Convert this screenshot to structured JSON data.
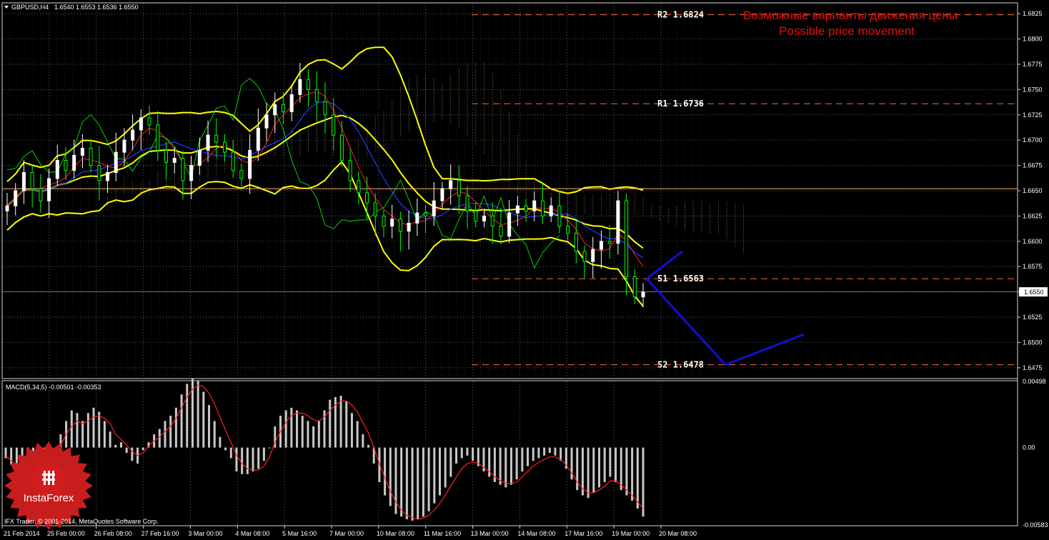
{
  "header": {
    "symbol": "GBPUSD,H4",
    "ohlc": "1.6540 1.6553 1.6536 1.6550"
  },
  "macd_header": {
    "label": "MACD(5,34,5)",
    "values": "-0.00501 -0.00353"
  },
  "footer": {
    "copyright": "IFX Trader, © 2001-2014, MetaQuotes Software Corp."
  },
  "annotation": {
    "line1": "Возможные варианты движения цены",
    "line2": "Possible price movement"
  },
  "logo": {
    "text": "InstaForex"
  },
  "colors": {
    "background": "#000000",
    "grid": "#7a8a8a",
    "bull": "#ffffff",
    "bear": "#00ff00",
    "bollinger": "#ffff00",
    "signal": "#ff2020",
    "kijun": "#1e3cff",
    "level_line": "#ff6a3a",
    "forecast": "#1010d0",
    "annotation": "#e01010",
    "current_price": "#8899aa",
    "hline": "#ffb060"
  },
  "levels": [
    {
      "name": "R2",
      "value": 1.6824,
      "label": "R2 1.6824"
    },
    {
      "name": "R1",
      "value": 1.6736,
      "label": "R1 1.6736"
    },
    {
      "name": "S1",
      "value": 1.6563,
      "label": "S1 1.6563"
    },
    {
      "name": "S2",
      "value": 1.6478,
      "label": "S2 1.6478"
    }
  ],
  "current_price": {
    "value": 1.655,
    "label": "1.6550"
  },
  "chart_data": [
    {
      "type": "line",
      "title": "GBPUSD,H4",
      "ylim": [
        1.6465,
        1.6835
      ],
      "y_ticks": [
        "1.6825",
        "1.6800",
        "1.6775",
        "1.6750",
        "1.6725",
        "1.6700",
        "1.6675",
        "1.6650",
        "1.6625",
        "1.6600",
        "1.6575",
        "1.6550",
        "1.6525",
        "1.6500",
        "1.6475"
      ],
      "x_ticks": [
        "21 Feb 2014",
        "25 Feb 00:00",
        "26 Feb 08:00",
        "27 Feb 16:00",
        "3 Mar 00:00",
        "4 Mar 08:00",
        "5 Mar 16:00",
        "7 Mar 00:00",
        "10 Mar 08:00",
        "11 Mar 16:00",
        "13 Mar 00:00",
        "14 Mar 08:00",
        "17 Mar 16:00",
        "19 Mar 00:00",
        "20 Mar 08:00"
      ],
      "grid": true,
      "horizontal_line": 1.6652,
      "series": [
        {
          "values": [
            1.6635,
            1.665,
            1.6668,
            1.6652,
            1.664,
            1.6662,
            1.668,
            1.667,
            1.6685,
            1.6692,
            1.6675,
            1.666,
            1.6668,
            1.6688,
            1.67,
            1.671,
            1.6722,
            1.6715,
            1.669,
            1.6678,
            1.6682,
            1.666,
            1.6675,
            1.669,
            1.6705,
            1.6698,
            1.6688,
            1.667,
            1.6662,
            1.669,
            1.6712,
            1.6725,
            1.6735,
            1.6728,
            1.6745,
            1.676,
            1.675,
            1.6738,
            1.6725,
            1.6705,
            1.668,
            1.666,
            1.6648,
            1.6638,
            1.6625,
            1.6615,
            1.6622,
            1.661,
            1.6618,
            1.6628,
            1.6625,
            1.664,
            1.6652,
            1.666,
            1.6645,
            1.663,
            1.662,
            1.6625,
            1.6615,
            1.6605,
            1.6628,
            1.6635,
            1.663,
            1.664,
            1.6625,
            1.6635,
            1.6615,
            1.6608,
            1.659,
            1.658,
            1.6592,
            1.66,
            1.6598,
            1.664,
            1.6565,
            1.6545,
            1.655
          ]
        }
      ]
    },
    {
      "type": "bar",
      "title": "MACD(5,34,5)",
      "ylim": [
        -0.00583,
        0.00498
      ],
      "y_ticks": [
        "0.00498",
        "0.00",
        "-0.00583"
      ],
      "series": [
        {
          "name": "MACD",
          "values": [
            -0.0008,
            -0.0013,
            -0.0016,
            -0.0015,
            -0.001,
            -0.0012,
            -0.0014,
            -0.0011,
            -0.0008,
            -0.0006,
            0.001,
            0.002,
            0.0028,
            0.0026,
            0.002,
            0.0026,
            0.003,
            0.0027,
            0.002,
            0.0012,
            0.0002,
            0.0004,
            -0.0004,
            -0.001,
            -0.0012,
            -0.0002,
            0.0004,
            0.001,
            0.0014,
            0.002,
            0.0024,
            0.003,
            0.004,
            0.0048,
            0.0052,
            0.005,
            0.0042,
            0.0032,
            0.002,
            0.0008,
            -0.0002,
            -0.0008,
            -0.0018,
            -0.002,
            -0.002,
            -0.0018,
            -0.0016,
            -0.001,
            0.0,
            0.0016,
            0.0024,
            0.0028,
            0.003,
            0.0028,
            0.0024,
            0.002,
            0.0016,
            0.002,
            0.0028,
            0.0036,
            0.0038,
            0.0039,
            0.0035,
            0.0026,
            0.002,
            0.001,
            0.0002,
            -0.0012,
            -0.0026,
            -0.0036,
            -0.0044,
            -0.005,
            -0.0052,
            -0.0054,
            -0.0055,
            -0.0054,
            -0.0052,
            -0.0048,
            -0.0042,
            -0.0036,
            -0.003,
            -0.0022,
            -0.0012,
            -0.0008,
            -0.0006,
            -0.001,
            -0.0014,
            -0.0018,
            -0.0022,
            -0.0026,
            -0.0028,
            -0.003,
            -0.0028,
            -0.0024,
            -0.0018,
            -0.0014,
            -0.001,
            -0.0008,
            -0.0006,
            -0.0004,
            -0.0006,
            -0.001,
            -0.0016,
            -0.0024,
            -0.0032,
            -0.0036,
            -0.0038,
            -0.0034,
            -0.003,
            -0.0026,
            -0.0022,
            -0.0026,
            -0.0032,
            -0.0036,
            -0.004,
            -0.0046,
            -0.0052
          ]
        },
        {
          "name": "Signal",
          "values": [
            -0.0006,
            -0.001,
            -0.0013,
            -0.0014,
            -0.0013,
            -0.0012,
            -0.0012,
            -0.0011,
            -0.0009,
            -0.0006,
            0.0002,
            0.001,
            0.0016,
            0.002,
            0.0018,
            0.002,
            0.0023,
            0.0024,
            0.0022,
            0.0018,
            0.001,
            0.0006,
            0.0002,
            -0.0003,
            -0.0006,
            -0.0004,
            0.0001,
            0.0005,
            0.0008,
            0.0012,
            0.0016,
            0.0022,
            0.003,
            0.0038,
            0.0044,
            0.0047,
            0.0046,
            0.0041,
            0.0033,
            0.0023,
            0.0013,
            0.0004,
            -0.0006,
            -0.0012,
            -0.0016,
            -0.0017,
            -0.0017,
            -0.0014,
            -0.0007,
            0.0004,
            0.0012,
            0.0019,
            0.0024,
            0.0026,
            0.0026,
            0.0024,
            0.0021,
            0.002,
            0.0023,
            0.0028,
            0.0032,
            0.0035,
            0.0035,
            0.0032,
            0.0027,
            0.0019,
            0.0011,
            0.0,
            -0.0012,
            -0.0023,
            -0.0033,
            -0.0041,
            -0.0047,
            -0.0051,
            -0.0053,
            -0.0054,
            -0.0053,
            -0.0051,
            -0.0047,
            -0.0042,
            -0.0036,
            -0.0029,
            -0.0022,
            -0.0016,
            -0.0012,
            -0.0011,
            -0.0012,
            -0.0015,
            -0.0018,
            -0.0022,
            -0.0025,
            -0.0027,
            -0.0027,
            -0.0026,
            -0.0022,
            -0.0018,
            -0.0014,
            -0.0011,
            -0.0009,
            -0.0007,
            -0.0007,
            -0.0009,
            -0.0013,
            -0.0019,
            -0.0026,
            -0.0031,
            -0.0034,
            -0.0034,
            -0.0032,
            -0.0029,
            -0.0025,
            -0.0025,
            -0.0028,
            -0.0032,
            -0.0036,
            -0.0041,
            -0.0046
          ]
        }
      ]
    }
  ],
  "forecast": [
    {
      "scenario": "up",
      "points": [
        [
          1.6563,
          0
        ],
        [
          1.659,
          1
        ]
      ]
    },
    {
      "scenario": "down",
      "points": [
        [
          1.6563,
          0
        ],
        [
          1.6478,
          1
        ],
        [
          1.6508,
          2
        ]
      ]
    }
  ]
}
